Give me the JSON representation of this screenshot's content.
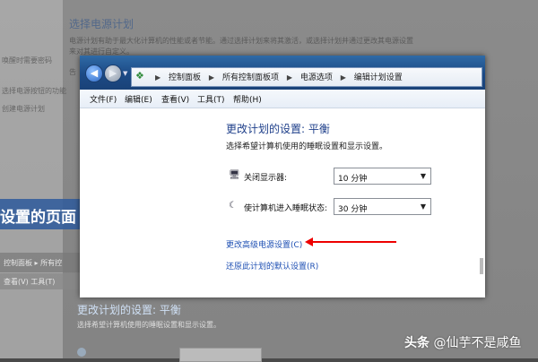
{
  "background": {
    "title": "选择电源计划",
    "lines": [
      "电源计划有助于最大化计算机的性能或者节能。通过选择计划来将其激活，或选择计划并通过更改其电源设置",
      "来对其进行自定义。",
      "告"
    ],
    "sidebar_items": [
      "控制面板主页",
      "唤醒时需要密码",
      "选择电源按钮的功能",
      "创建电源计划"
    ],
    "banner_text": "设置的页面",
    "band1_text": "控制面板 ▸ 所有控",
    "band2_text": "查看(V)    工具(T)",
    "bottom_title": "更改计划的设置: 平衡",
    "bottom_sub": "选择希望计算机使用的睡眠设置和显示设置。"
  },
  "window": {
    "address": {
      "crumbs": [
        "控制面板",
        "所有控制面板项",
        "电源选项",
        "编辑计划设置"
      ]
    },
    "menu": [
      "文件(F)",
      "编辑(E)",
      "查看(V)",
      "工具(T)",
      "帮助(H)"
    ],
    "heading": "更改计划的设置: 平衡",
    "subheading": "选择希望计算机使用的睡眠设置和显示设置。",
    "settings": [
      {
        "label": "关闭显示器:",
        "value": "10 分钟",
        "icon": "monitor-icon"
      },
      {
        "label": "使计算机进入睡眠状态:",
        "value": "30 分钟",
        "icon": "moon-icon"
      }
    ],
    "links": {
      "advanced": "更改高级电源设置(C)",
      "restore": "还原此计划的默认设置(R)"
    },
    "annotation_color": "#e00000"
  },
  "watermark": {
    "brand": "头条",
    "author": "@仙芋不是咸鱼"
  }
}
